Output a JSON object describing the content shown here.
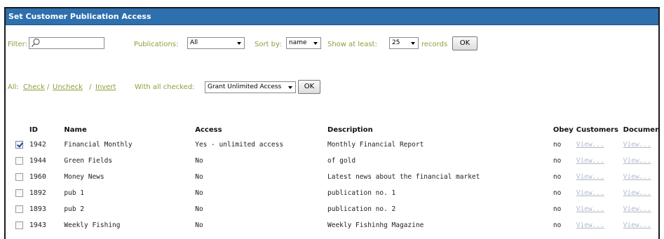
{
  "title": "Set Customer Publication Access",
  "toolbar": {
    "filter_label": "Filter:",
    "filter_value": "",
    "publications_label": "Publications:",
    "publications_selected": "All",
    "sortby_label": "Sort by:",
    "sortby_selected": "name",
    "show_label": "Show at least:",
    "show_selected": "25",
    "records_label": "records",
    "ok_label": "OK"
  },
  "bulk": {
    "all_label": "All:",
    "check": "Check",
    "uncheck": "Uncheck",
    "invert": "Invert",
    "sep": "/",
    "with_all_checked_label": "With all checked:",
    "action_selected": "Grant Unlimited Access",
    "ok_label": "OK"
  },
  "table": {
    "headers": {
      "id": "ID",
      "name": "Name",
      "access": "Access",
      "description": "Description",
      "obey": "Obey",
      "customers": "Customers",
      "documents": "Documents"
    },
    "rows": [
      {
        "checked": true,
        "id": "1942",
        "name": "Financial Monthly",
        "access": "Yes - unlimited access",
        "description": "Monthly Financial Report",
        "obey": "no",
        "customers": "View...",
        "documents": "View..."
      },
      {
        "checked": false,
        "id": "1944",
        "name": "Green Fields",
        "access": "No",
        "description": "of gold",
        "obey": "no",
        "customers": "View...",
        "documents": "View..."
      },
      {
        "checked": false,
        "id": "1960",
        "name": "Money News",
        "access": "No",
        "description": "Latest news about the financial market",
        "obey": "no",
        "customers": "View...",
        "documents": "View..."
      },
      {
        "checked": false,
        "id": "1892",
        "name": "pub 1",
        "access": "No",
        "description": "publication no. 1",
        "obey": "no",
        "customers": "View...",
        "documents": "View..."
      },
      {
        "checked": false,
        "id": "1893",
        "name": "pub 2",
        "access": "No",
        "description": "publication no. 2",
        "obey": "no",
        "customers": "View...",
        "documents": "View..."
      },
      {
        "checked": false,
        "id": "1943",
        "name": "Weekly Fishing",
        "access": "No",
        "description": "Weekly Fishinhg Magazine",
        "obey": "no",
        "customers": "View...",
        "documents": "View..."
      }
    ]
  },
  "colors": {
    "titlebar": "#2e6fae",
    "label_olive": "#8e9f3c",
    "view_link": "#b0b9c8"
  }
}
